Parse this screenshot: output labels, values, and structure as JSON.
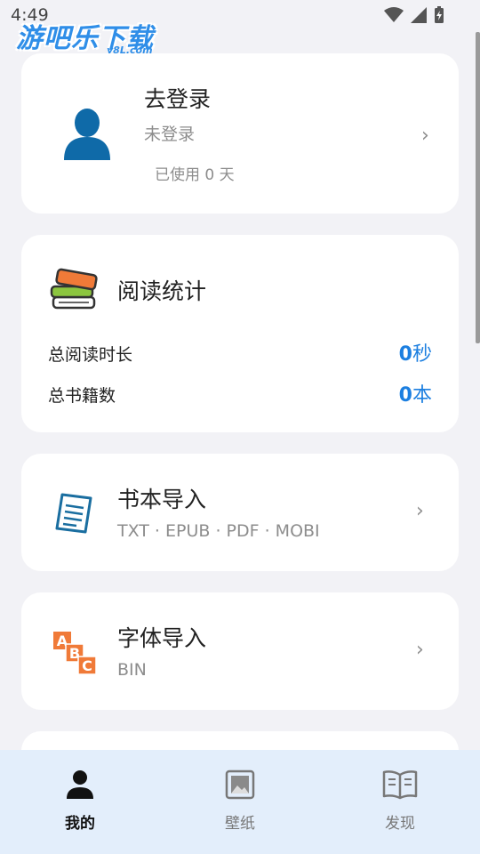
{
  "status_bar": {
    "time": "4:49",
    "watermark_main": "游吧乐下载",
    "watermark_sub": "y8L.com"
  },
  "login": {
    "title": "去登录",
    "status": "未登录",
    "days_used": "已使用 0 天",
    "icon": "user-avatar-icon"
  },
  "stats": {
    "title": "阅读统计",
    "icon": "books-stack-icon",
    "rows": [
      {
        "label": "总阅读时长",
        "value": "0",
        "unit": "秒"
      },
      {
        "label": "总书籍数",
        "value": "0",
        "unit": "本"
      }
    ]
  },
  "book_import": {
    "title": "书本导入",
    "formats": "TXT · EPUB · PDF · MOBI",
    "icon": "document-icon"
  },
  "font_import": {
    "title": "字体导入",
    "formats": "BIN",
    "icon": "abc-blocks-icon"
  },
  "bottom_nav": {
    "items": [
      {
        "label": "我的",
        "icon": "person-icon",
        "active": true
      },
      {
        "label": "壁纸",
        "icon": "image-icon",
        "active": false
      },
      {
        "label": "发现",
        "icon": "open-book-icon",
        "active": false
      }
    ]
  },
  "colors": {
    "accent": "#1c7fe0",
    "avatar": "#0f6aa8",
    "nav_background": "#e3eefb"
  }
}
